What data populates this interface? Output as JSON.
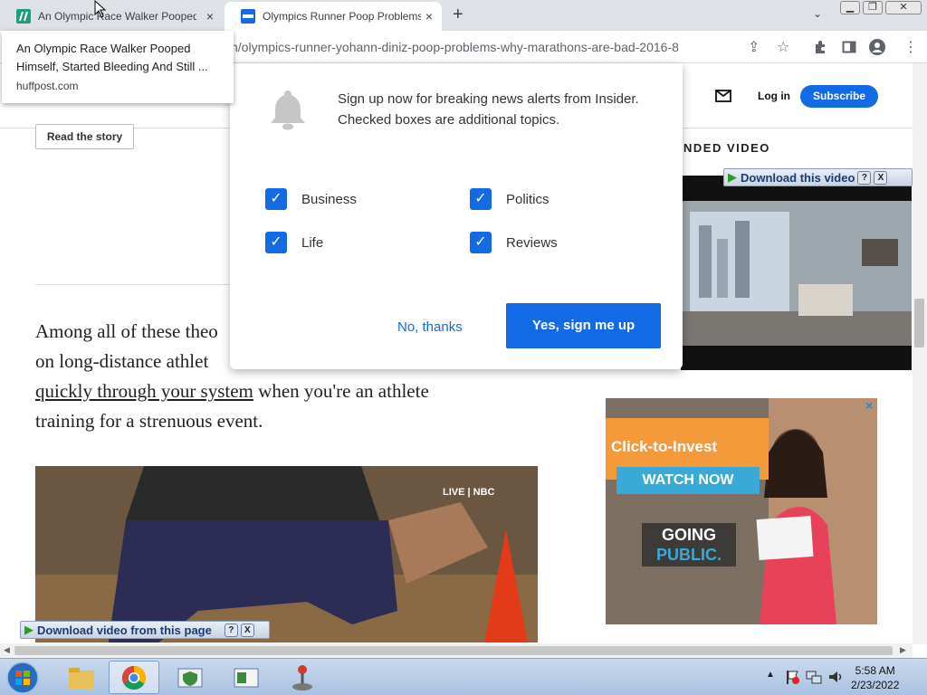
{
  "browser": {
    "tabs": [
      {
        "title": "An Olympic Race Walker Pooped",
        "active": false
      },
      {
        "title": "Olympics Runner Poop Problems",
        "active": true
      }
    ],
    "url": "n/olympics-runner-yohann-diniz-poop-problems-why-marathons-are-bad-2016-8",
    "new_tab": "+",
    "close": "×",
    "window_min": "▁",
    "window_max": "❐",
    "window_close": "✕"
  },
  "hover_card": {
    "title": "An Olympic Race Walker Pooped Himself, Started Bleeding And Still ...",
    "domain": "huffpost.com"
  },
  "site": {
    "login": "Log in",
    "subscribe": "Subscribe",
    "read_story": "Read the story",
    "recommended_label": "NDED VIDEO",
    "body_line1": "Among all of these theo",
    "body_line2": "on long-distance athlet",
    "body_line3_link": "quickly through your system",
    "body_line3_rest": " when you're an athlete",
    "body_line4": "training for a strenuous event.",
    "video_badge": "LIVE | NBC"
  },
  "ad": {
    "headline": "Click-to-Invest",
    "cta": "WATCH NOW",
    "brand_line1": "GOING",
    "brand_line2": "PUBLIC.",
    "close": "×"
  },
  "modal": {
    "message": "Sign up now for breaking news alerts from Insider. Checked boxes are additional topics.",
    "topics": [
      {
        "label": "Business",
        "checked": true
      },
      {
        "label": "Politics",
        "checked": true
      },
      {
        "label": "Life",
        "checked": true
      },
      {
        "label": "Reviews",
        "checked": true
      }
    ],
    "decline": "No, thanks",
    "accept": "Yes, sign me up"
  },
  "download_bars": {
    "top": "Download this video",
    "bottom": "Download video from this page",
    "help": "?",
    "close": "X"
  },
  "taskbar": {
    "time": "5:58 AM",
    "date": "2/23/2022"
  },
  "colors": {
    "accent": "#136ae5",
    "ad_orange": "#f59a3a",
    "ad_blue": "#39a9d8"
  }
}
